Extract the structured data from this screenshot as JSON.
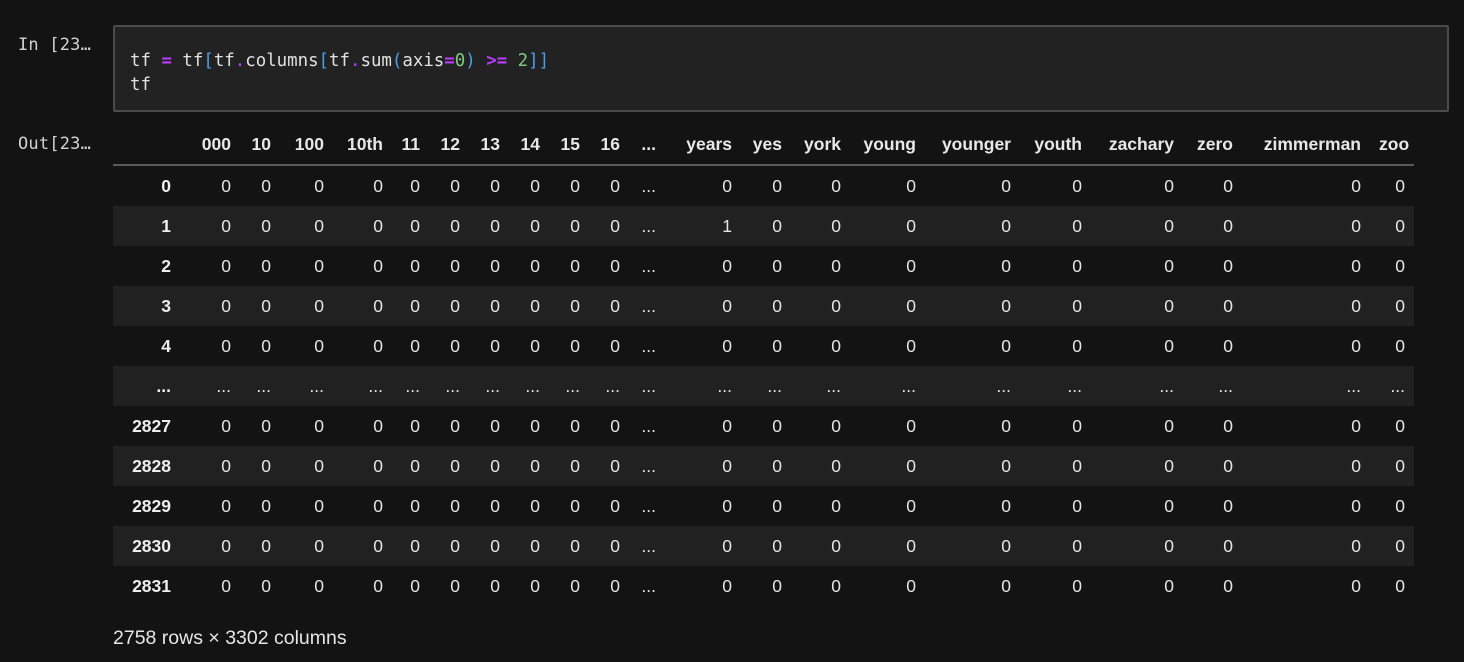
{
  "input_prompt": "In [23…",
  "output_prompt": "Out[23…",
  "code": {
    "line1": {
      "t1": "tf",
      "t2": " ",
      "t3": "=",
      "t4": " tf",
      "t5": "[",
      "t6": "tf",
      "t7": ".",
      "t8": "columns",
      "t9": "[",
      "t10": "tf",
      "t11": ".",
      "t12": "sum",
      "t13": "(",
      "t14": "axis",
      "t15": "=",
      "t16": "0",
      "t17": ")",
      "t18": " ",
      "t19": ">=",
      "t20": " ",
      "t21": "2",
      "t22": "]]"
    },
    "line2": "tf"
  },
  "dataframe": {
    "columns": [
      "000",
      "10",
      "100",
      "10th",
      "11",
      "12",
      "13",
      "14",
      "15",
      "16",
      "...",
      "years",
      "yes",
      "york",
      "young",
      "younger",
      "youth",
      "zachary",
      "zero",
      "zimmerman",
      "zoo"
    ],
    "rows": [
      {
        "index": "0",
        "values": [
          "0",
          "0",
          "0",
          "0",
          "0",
          "0",
          "0",
          "0",
          "0",
          "0",
          "...",
          "0",
          "0",
          "0",
          "0",
          "0",
          "0",
          "0",
          "0",
          "0",
          "0"
        ]
      },
      {
        "index": "1",
        "values": [
          "0",
          "0",
          "0",
          "0",
          "0",
          "0",
          "0",
          "0",
          "0",
          "0",
          "...",
          "1",
          "0",
          "0",
          "0",
          "0",
          "0",
          "0",
          "0",
          "0",
          "0"
        ]
      },
      {
        "index": "2",
        "values": [
          "0",
          "0",
          "0",
          "0",
          "0",
          "0",
          "0",
          "0",
          "0",
          "0",
          "...",
          "0",
          "0",
          "0",
          "0",
          "0",
          "0",
          "0",
          "0",
          "0",
          "0"
        ]
      },
      {
        "index": "3",
        "values": [
          "0",
          "0",
          "0",
          "0",
          "0",
          "0",
          "0",
          "0",
          "0",
          "0",
          "...",
          "0",
          "0",
          "0",
          "0",
          "0",
          "0",
          "0",
          "0",
          "0",
          "0"
        ]
      },
      {
        "index": "4",
        "values": [
          "0",
          "0",
          "0",
          "0",
          "0",
          "0",
          "0",
          "0",
          "0",
          "0",
          "...",
          "0",
          "0",
          "0",
          "0",
          "0",
          "0",
          "0",
          "0",
          "0",
          "0"
        ]
      },
      {
        "index": "...",
        "values": [
          "...",
          "...",
          "...",
          "...",
          "...",
          "...",
          "...",
          "...",
          "...",
          "...",
          "...",
          "...",
          "...",
          "...",
          "...",
          "...",
          "...",
          "...",
          "...",
          "...",
          "..."
        ]
      },
      {
        "index": "2827",
        "values": [
          "0",
          "0",
          "0",
          "0",
          "0",
          "0",
          "0",
          "0",
          "0",
          "0",
          "...",
          "0",
          "0",
          "0",
          "0",
          "0",
          "0",
          "0",
          "0",
          "0",
          "0"
        ]
      },
      {
        "index": "2828",
        "values": [
          "0",
          "0",
          "0",
          "0",
          "0",
          "0",
          "0",
          "0",
          "0",
          "0",
          "...",
          "0",
          "0",
          "0",
          "0",
          "0",
          "0",
          "0",
          "0",
          "0",
          "0"
        ]
      },
      {
        "index": "2829",
        "values": [
          "0",
          "0",
          "0",
          "0",
          "0",
          "0",
          "0",
          "0",
          "0",
          "0",
          "...",
          "0",
          "0",
          "0",
          "0",
          "0",
          "0",
          "0",
          "0",
          "0",
          "0"
        ]
      },
      {
        "index": "2830",
        "values": [
          "0",
          "0",
          "0",
          "0",
          "0",
          "0",
          "0",
          "0",
          "0",
          "0",
          "...",
          "0",
          "0",
          "0",
          "0",
          "0",
          "0",
          "0",
          "0",
          "0",
          "0"
        ]
      },
      {
        "index": "2831",
        "values": [
          "0",
          "0",
          "0",
          "0",
          "0",
          "0",
          "0",
          "0",
          "0",
          "0",
          "...",
          "0",
          "0",
          "0",
          "0",
          "0",
          "0",
          "0",
          "0",
          "0",
          "0"
        ]
      }
    ]
  },
  "shape_text": "2758 rows × 3302 columns"
}
